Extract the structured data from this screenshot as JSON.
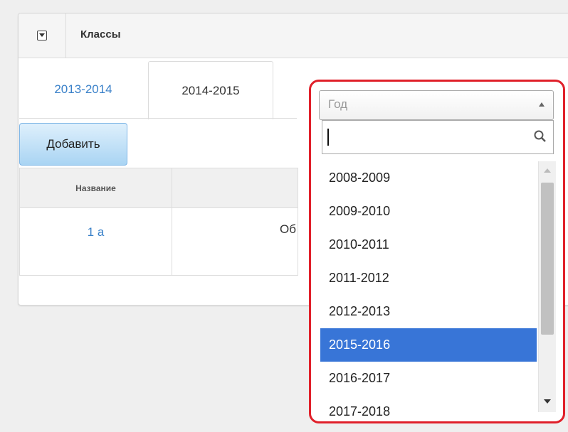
{
  "panel": {
    "title": "Классы"
  },
  "tabs": [
    {
      "label": "2013-2014",
      "active": false
    },
    {
      "label": "2014-2015",
      "active": true
    }
  ],
  "toolbar": {
    "add_label": "Добавить"
  },
  "table": {
    "columns": [
      "Название"
    ],
    "rows": [
      {
        "name": "1 a",
        "description_partial": "Об"
      }
    ]
  },
  "year_select": {
    "placeholder": "Год",
    "search_value": "",
    "options": [
      "2008-2009",
      "2009-2010",
      "2010-2011",
      "2011-2012",
      "2012-2013",
      "2015-2016",
      "2016-2017",
      "2017-2018"
    ],
    "highlighted": "2015-2016"
  },
  "colors": {
    "accent": "#3a81c9",
    "selected_option": "#3875d7",
    "highlight_border": "#e0202a"
  }
}
